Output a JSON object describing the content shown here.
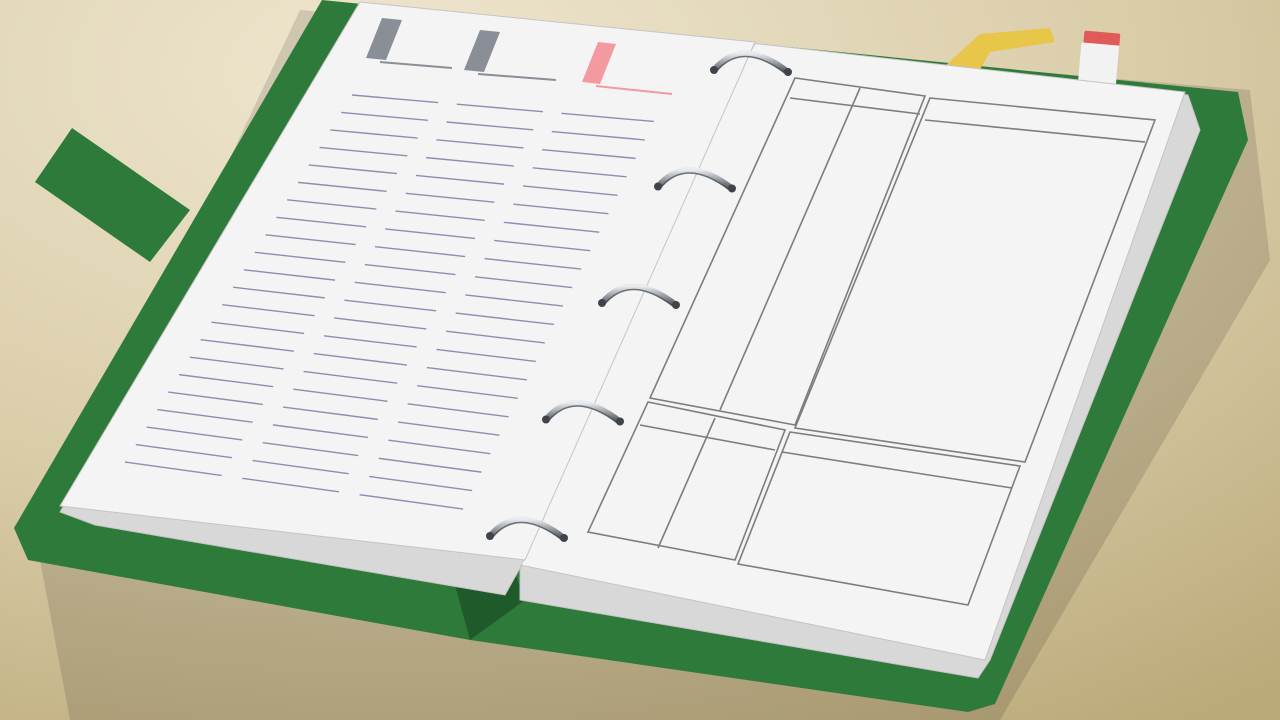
{
  "scene": {
    "subject": "open-ring-binder-planner",
    "colors": {
      "table_light": "#efe6cf",
      "table_mid": "#d9cca8",
      "table_dark": "#bba979",
      "cover_green": "#2e7a3a",
      "cover_green_dark": "#1f5a2a",
      "cover_green_light": "#3a8c46",
      "page_white": "#f4f4f4",
      "page_edge": "#d8d8d8",
      "rule_line": "#8a8fb0",
      "grid_line": "#7d7d7d",
      "tab_gray": "#8a8f97",
      "tab_pink": "#f29aa0",
      "ring_metal": "#9a9fa6",
      "ribbon_yellow": "#e8c64a",
      "ribbon_red": "#e05a5a"
    },
    "rings": 5,
    "rule_columns": 3,
    "rule_rows": 22
  }
}
